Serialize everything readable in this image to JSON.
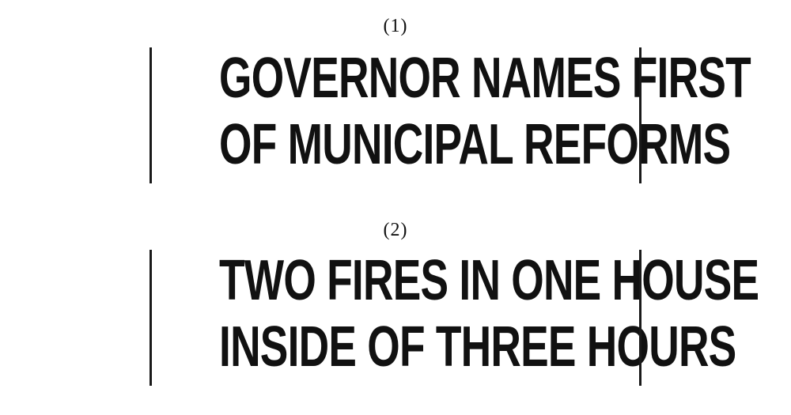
{
  "examples": [
    {
      "number": "(1)",
      "headline": {
        "line1": "GOVERNOR NAMES FIRST",
        "line2": "OF MUNICIPAL REFORMS"
      }
    },
    {
      "number": "(2)",
      "headline": {
        "line1": "TWO FIRES IN ONE HOUSE",
        "line2": "INSIDE OF THREE HOURS"
      }
    }
  ]
}
